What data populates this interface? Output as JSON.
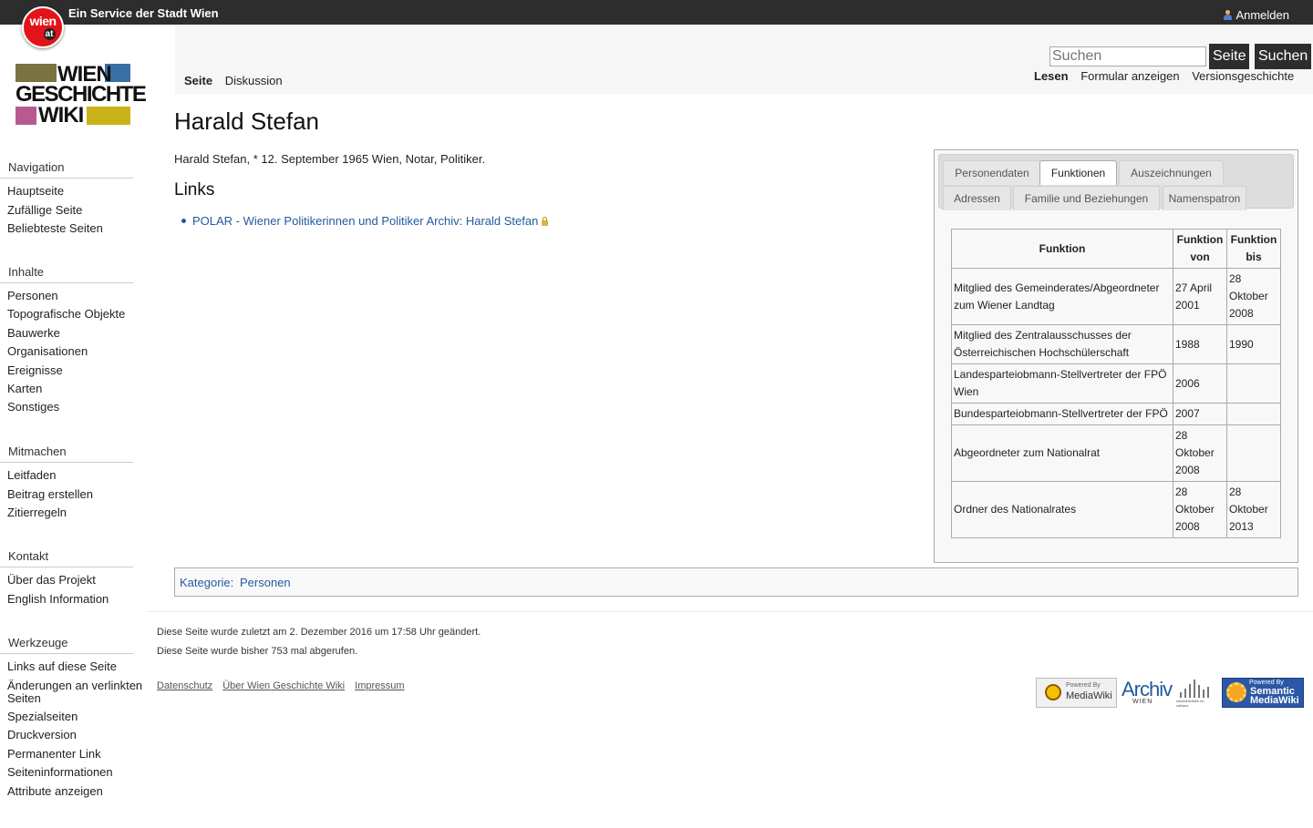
{
  "topbar": {
    "service": "Ein Service der Stadt Wien",
    "login": "Anmelden",
    "badge_line1": "wien",
    "badge_line2": "at"
  },
  "logo": {
    "line1": "WIEN",
    "line2": "GESCHICHTE",
    "line3": "WIKI",
    "colors": [
      "#7a7340",
      "#3a6fa3",
      "#b85a8f",
      "#c9b319"
    ]
  },
  "sidebar": [
    {
      "heading": "Navigation",
      "items": [
        "Hauptseite",
        "Zufällige Seite",
        "Beliebteste Seiten"
      ]
    },
    {
      "heading": "Inhalte",
      "items": [
        "Personen",
        "Topografische Objekte",
        "Bauwerke",
        "Organisationen",
        "Ereignisse",
        "Karten",
        "Sonstiges"
      ]
    },
    {
      "heading": "Mitmachen",
      "items": [
        "Leitfaden",
        "Beitrag erstellen",
        "Zitierregeln"
      ]
    },
    {
      "heading": "Kontakt",
      "items": [
        "Über das Projekt",
        "English Information"
      ]
    },
    {
      "heading": "Werkzeuge",
      "items": [
        "Links auf diese Seite",
        "Änderungen an verlinkten Seiten",
        "Spezialseiten",
        "Druckversion",
        "Permanenter Link",
        "Seiteninformationen",
        "Attribute anzeigen"
      ]
    }
  ],
  "tabs": {
    "page": "Seite",
    "discussion": "Diskussion",
    "read": "Lesen",
    "form": "Formular anzeigen",
    "history": "Versionsgeschichte"
  },
  "search": {
    "placeholder": "Suchen",
    "go": "Seite",
    "search": "Suchen"
  },
  "content": {
    "title": "Harald Stefan",
    "intro": "Harald Stefan, * 12. September 1965 Wien, Notar, Politiker.",
    "links_heading": "Links",
    "links": [
      "POLAR - Wiener Politikerinnen und Politiker Archiv: Harald Stefan"
    ]
  },
  "infobox": {
    "tabs_row1": [
      "Personendaten",
      "Funktionen",
      "Auszeichnungen"
    ],
    "tabs_row2": [
      "Adressen",
      "Familie und Beziehungen",
      "Namenspatron"
    ],
    "active_tab": "Funktionen",
    "headers": [
      "Funktion",
      "Funktion von",
      "Funktion bis"
    ],
    "rows": [
      [
        "Mitglied des Gemeinderates/Abgeordneter zum Wiener Landtag",
        "27 April 2001",
        "28 Oktober 2008"
      ],
      [
        "Mitglied des Zentralausschusses der Österreichischen Hochschülerschaft",
        "1988",
        "1990"
      ],
      [
        "Landesparteiobmann-Stellvertreter der FPÖ Wien",
        "2006",
        ""
      ],
      [
        "Bundesparteiobmann-Stellvertreter der FPÖ",
        "2007",
        ""
      ],
      [
        "Abgeordneter zum Nationalrat",
        "28 Oktober 2008",
        ""
      ],
      [
        "Ordner des Nationalrates",
        "28 Oktober 2008",
        "28 Oktober 2013"
      ]
    ]
  },
  "category": {
    "label": "Kategorie",
    "value": "Personen"
  },
  "footer": {
    "lastmod": "Diese Seite wurde zuletzt am 2. Dezember 2016 um 17:58 Uhr geändert.",
    "views": "Diese Seite wurde bisher 753 mal abgerufen.",
    "links": [
      "Datenschutz",
      "Über Wien Geschichte Wiki",
      "Impressum"
    ],
    "badges": {
      "mediawiki_small": "Powered By",
      "mediawiki": "MediaWiki",
      "archiv": "Archiv",
      "archiv_sub": "WIEN",
      "wbr": "wienbibliothek im rathaus",
      "smw_small": "Powered By",
      "smw_line1": "Semantic",
      "smw_line2": "MediaWiki"
    }
  }
}
